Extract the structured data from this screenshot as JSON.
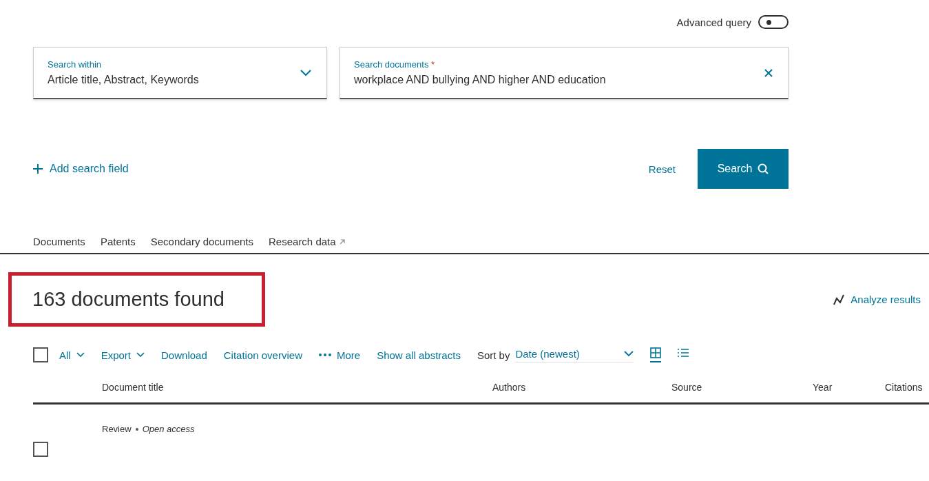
{
  "advanced_query": {
    "label": "Advanced query",
    "on": false
  },
  "search_within": {
    "label": "Search within",
    "value": "Article title, Abstract, Keywords"
  },
  "search_documents": {
    "label": "Search documents",
    "required_mark": "*",
    "value": "workplace AND bullying AND higher AND education"
  },
  "add_search_field": "Add search field",
  "reset": "Reset",
  "search_button": "Search",
  "tabs": [
    {
      "label": "Documents",
      "external": false
    },
    {
      "label": "Patents",
      "external": false
    },
    {
      "label": "Secondary documents",
      "external": false
    },
    {
      "label": "Research data",
      "external": true
    }
  ],
  "results_count": "163 documents found",
  "analyze_results": "Analyze results",
  "toolbar": {
    "select_all": {
      "label": "All",
      "checked": false
    },
    "export": "Export",
    "download": "Download",
    "citation_overview": "Citation overview",
    "more": "More",
    "show_all_abstracts": "Show all abstracts",
    "sort_label": "Sort by",
    "sort_value": "Date (newest)",
    "views": [
      {
        "kind": "grid",
        "selected": true
      },
      {
        "kind": "list",
        "selected": false
      }
    ]
  },
  "table": {
    "columns": [
      "Document title",
      "Authors",
      "Source",
      "Year",
      "Citations"
    ],
    "rows": [
      {
        "type": "Review",
        "access": "Open access",
        "checked": false
      }
    ]
  }
}
